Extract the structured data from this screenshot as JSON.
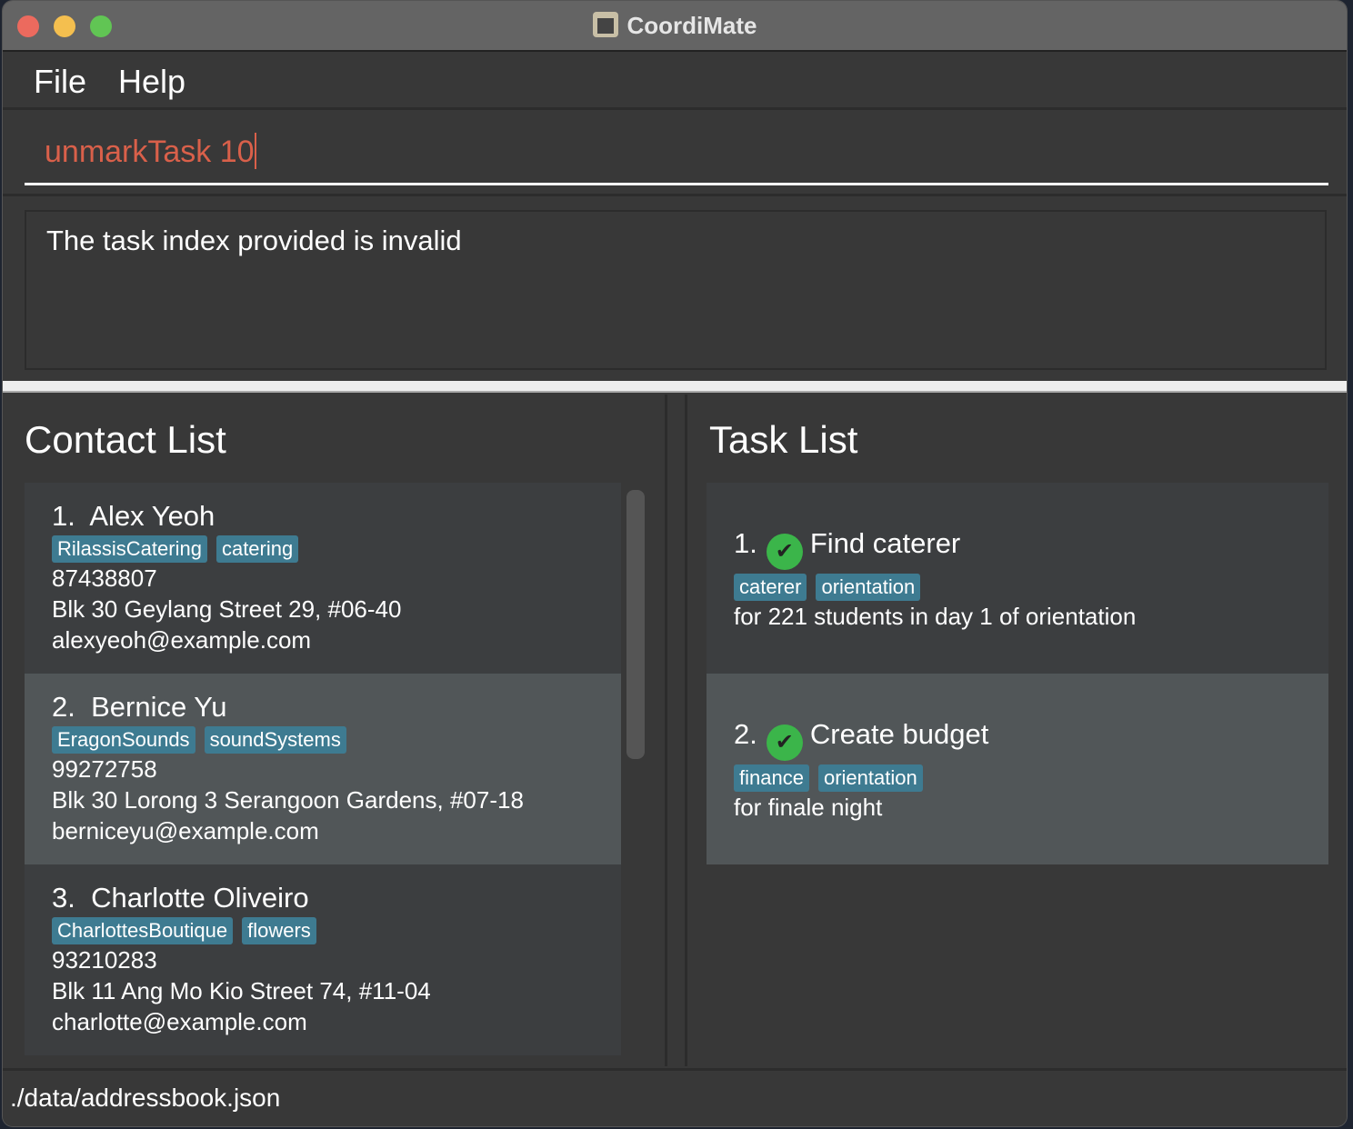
{
  "window": {
    "title": "CoordiMate"
  },
  "menu": [
    "File",
    "Help"
  ],
  "command": {
    "value": "unmarkTask 10"
  },
  "result": "The task index provided is invalid",
  "contacts": {
    "title": "Contact List",
    "items": [
      {
        "index": "1.",
        "name": "Alex Yeoh",
        "tags": [
          "RilassisCatering",
          "catering"
        ],
        "phone": "87438807",
        "address": "Blk 30 Geylang Street 29, #06-40",
        "email": "alexyeoh@example.com"
      },
      {
        "index": "2.",
        "name": "Bernice Yu",
        "tags": [
          "EragonSounds",
          "soundSystems"
        ],
        "phone": "99272758",
        "address": "Blk 30 Lorong 3 Serangoon Gardens, #07-18",
        "email": "berniceyu@example.com"
      },
      {
        "index": "3.",
        "name": "Charlotte Oliveiro",
        "tags": [
          "CharlottesBoutique",
          "flowers"
        ],
        "phone": "93210283",
        "address": "Blk 11 Ang Mo Kio Street 74, #11-04",
        "email": "charlotte@example.com"
      }
    ]
  },
  "tasks": {
    "title": "Task List",
    "items": [
      {
        "index": "1.",
        "title": "Find caterer",
        "done": true,
        "tags": [
          "caterer",
          "orientation"
        ],
        "note": "for 221 students in day 1 of orientation"
      },
      {
        "index": "2.",
        "title": "Create budget",
        "done": true,
        "tags": [
          "finance",
          "orientation"
        ],
        "note": "for finale night"
      }
    ]
  },
  "status": "./data/addressbook.json"
}
